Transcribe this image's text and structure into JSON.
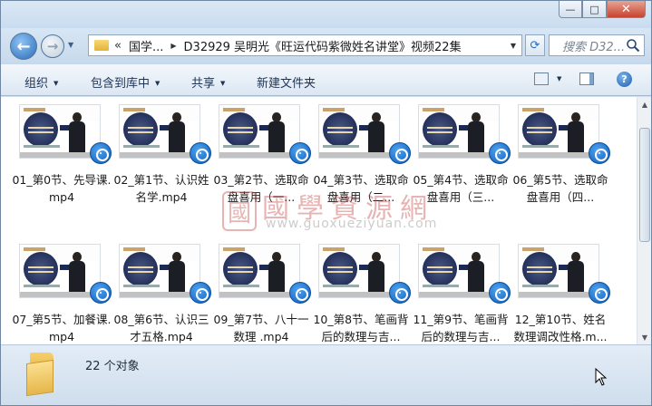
{
  "window": {
    "minimize_glyph": "—",
    "maximize_glyph": "□",
    "close_glyph": "✕"
  },
  "nav": {
    "back_glyph": "←",
    "forward_glyph": "→",
    "address_chevron": "«",
    "breadcrumbs": [
      "国学...",
      "D32929  吴明光《旺运代码紫微姓名讲堂》视频22集"
    ],
    "breadcrumb_sep": "▶",
    "search_placeholder": "搜索 D32..."
  },
  "toolbar": {
    "organize": "组织",
    "include_in_library": "包含到库中",
    "share": "共享",
    "new_folder": "新建文件夹"
  },
  "watermark": {
    "seal": "國",
    "title": "國學資源網",
    "url": "www.guoxueziyuan.com"
  },
  "files": [
    {
      "label": "01_第0节、先导课.mp4"
    },
    {
      "label": "02_第1节、认识姓名学.mp4"
    },
    {
      "label": "03_第2节、选取命盘喜用（一..."
    },
    {
      "label": "04_第3节、选取命盘喜用（二..."
    },
    {
      "label": "05_第4节、选取命盘喜用（三..."
    },
    {
      "label": "06_第5节、选取命盘喜用（四..."
    },
    {
      "label": "07_第5节、加餐课.mp4"
    },
    {
      "label": "08_第6节、认识三才五格.mp4"
    },
    {
      "label": "09_第7节、八十一数理 .mp4"
    },
    {
      "label": "10_第8节、笔画背后的数理与吉..."
    },
    {
      "label": "11_第9节、笔画背后的数理与吉..."
    },
    {
      "label": "12_第10节、姓名数理调改性格.m..."
    }
  ],
  "status": {
    "item_count": "22 个对象"
  },
  "colors": {
    "title_gradient_top": "#dbe8f5",
    "close_button": "#c7432d",
    "accent_blue": "#2a6cb8",
    "folder_yellow": "#f6cf6a"
  }
}
